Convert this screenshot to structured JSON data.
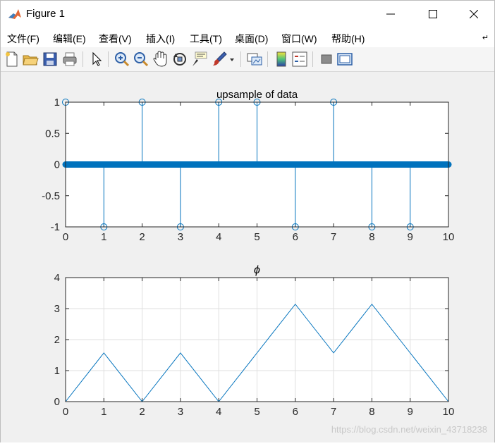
{
  "window": {
    "title": "Figure 1",
    "controls": [
      "minimize",
      "maximize",
      "close"
    ]
  },
  "menu": [
    {
      "label": "文件(F)"
    },
    {
      "label": "编辑(E)"
    },
    {
      "label": "查看(V)"
    },
    {
      "label": "插入(I)"
    },
    {
      "label": "工具(T)"
    },
    {
      "label": "桌面(D)"
    },
    {
      "label": "窗口(W)"
    },
    {
      "label": "帮助(H)"
    }
  ],
  "toolbar": {
    "icons": [
      "new-figure-icon",
      "open-file-icon",
      "save-icon",
      "print-icon",
      "edit-plot-arrow-icon",
      "zoom-in-icon",
      "zoom-out-icon",
      "pan-hand-icon",
      "rotate-3d-icon",
      "data-cursor-icon",
      "brush-icon",
      "link-plot-icon",
      "colorbar-icon",
      "legend-icon",
      "hide-plot-tools-icon",
      "show-plot-tools-icon"
    ]
  },
  "chart_data": [
    {
      "type": "stem",
      "title": "upsample of data",
      "xlabel": "",
      "ylabel": "",
      "xlim": [
        0,
        10
      ],
      "ylim": [
        -1,
        1
      ],
      "xticks": [
        "0",
        "1",
        "2",
        "3",
        "4",
        "5",
        "6",
        "7",
        "8",
        "9",
        "10"
      ],
      "yticks": [
        "-1",
        "-0.5",
        "0",
        "0.5",
        "1"
      ],
      "grid": false,
      "color": "#0072bd",
      "stems": [
        {
          "x": 0,
          "y": 1
        },
        {
          "x": 1,
          "y": -1
        },
        {
          "x": 2,
          "y": 1
        },
        {
          "x": 3,
          "y": -1
        },
        {
          "x": 4,
          "y": 1
        },
        {
          "x": 5,
          "y": 1
        },
        {
          "x": 6,
          "y": -1
        },
        {
          "x": 7,
          "y": 1
        },
        {
          "x": 8,
          "y": -1
        },
        {
          "x": 9,
          "y": -1
        }
      ],
      "zero_band": {
        "from": 0,
        "to": 10,
        "y": 0
      }
    },
    {
      "type": "line",
      "title": "ϕ",
      "xlabel": "",
      "ylabel": "",
      "xlim": [
        0,
        10
      ],
      "ylim": [
        0,
        4
      ],
      "xticks": [
        "0",
        "1",
        "2",
        "3",
        "4",
        "5",
        "6",
        "7",
        "8",
        "9",
        "10"
      ],
      "yticks": [
        "0",
        "1",
        "2",
        "3",
        "4"
      ],
      "grid": true,
      "color": "#0072bd",
      "x": [
        0,
        1,
        2,
        3,
        4,
        5,
        6,
        7,
        8,
        9,
        10
      ],
      "y": [
        0,
        1.571,
        0,
        1.571,
        0,
        1.571,
        3.142,
        1.571,
        3.142,
        1.571,
        0
      ]
    }
  ],
  "watermark": "https://blog.csdn.net/weixin_43718238"
}
